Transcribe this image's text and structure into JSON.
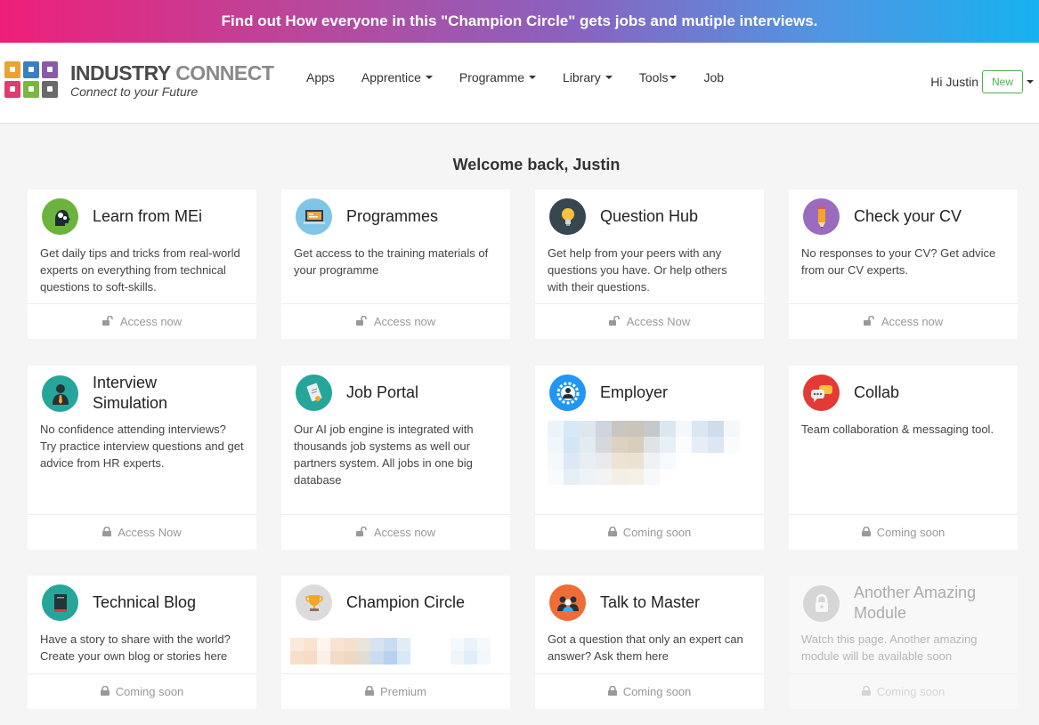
{
  "banner": {
    "text": "Find out How everyone in this \"Champion Circle\" gets jobs and mutiple interviews."
  },
  "logo": {
    "title_part1": "INDUSTRY",
    "title_part2": "CONNECT",
    "subtitle": "Connect to your Future",
    "colors": [
      "#e8a433",
      "#3a7fc1",
      "#8a5aa8",
      "#e23b6f",
      "#7ab73e",
      "#6a6a6a"
    ]
  },
  "nav": {
    "items": [
      {
        "label": "Apps",
        "dropdown": false
      },
      {
        "label": "Apprentice",
        "dropdown": true
      },
      {
        "label": "Programme",
        "dropdown": true
      },
      {
        "label": "Library",
        "dropdown": true
      },
      {
        "label": "Tools",
        "dropdown": true
      },
      {
        "label": "Job",
        "dropdown": false
      }
    ]
  },
  "user": {
    "greeting": "Hi Justin",
    "badge": "New"
  },
  "welcome": "Welcome back, Justin",
  "cards": [
    {
      "title": "Learn from MEi",
      "desc": "Get daily tips and tricks from real-world experts on everything from technical questions to soft-skills.",
      "action": "Access now",
      "icon": "gears-head-icon",
      "color": "#6cb33e",
      "locked": false
    },
    {
      "title": "Programmes",
      "desc": "Get access to the training materials of your programme",
      "action": "Access now",
      "icon": "laptop-icon",
      "color": "#7fc6e6",
      "locked": false
    },
    {
      "title": "Question Hub",
      "desc": "Get help from your peers with any questions you have. Or help others with their questions.",
      "action": "Access Now",
      "icon": "lightbulb-icon",
      "color": "#37474f",
      "locked": false
    },
    {
      "title": "Check your CV",
      "desc": "No responses to your CV? Get advice from our CV experts.",
      "action": "Access now",
      "icon": "pencil-icon",
      "color": "#9b6bbf",
      "locked": false
    },
    {
      "title": "Interview Simulation",
      "desc": "No confidence attending interviews? Try practice interview questions and get advice from HR experts.",
      "action": "Access Now",
      "icon": "interviewer-icon",
      "color": "#26a69a",
      "locked": true
    },
    {
      "title": "Job Portal",
      "desc": "Our AI job engine is integrated with thousands job systems as well our partners system. All jobs in one big database",
      "action": "Access now",
      "icon": "certificate-icon",
      "color": "#26a69a",
      "locked": false
    },
    {
      "title": "Employer",
      "desc": "",
      "action": "Coming soon",
      "icon": "employer-gear-icon",
      "color": "#2196f3",
      "locked": true
    },
    {
      "title": "Collab",
      "desc": "Team collaboration & messaging tool.",
      "action": "Coming soon",
      "icon": "chat-bubbles-icon",
      "color": "#e53935",
      "locked": true
    },
    {
      "title": "Technical Blog",
      "desc": "Have a story to share with the world? Create your own blog or stories here",
      "action": "Coming soon",
      "icon": "book-icon",
      "color": "#26a69a",
      "locked": true
    },
    {
      "title": "Champion Circle",
      "desc": "",
      "action": "Premium",
      "icon": "trophy-icon",
      "color": "#cccccc",
      "locked": true
    },
    {
      "title": "Talk to Master",
      "desc": "Got a question that only an expert can answer? Ask them here",
      "action": "Coming soon",
      "icon": "group-icon",
      "color": "#ef6c36",
      "locked": true
    },
    {
      "title": "Another Amazing Module",
      "desc": "Watch this page. Another amazing module will be available soon",
      "action": "Coming soon",
      "icon": "padlock-icon",
      "color": "#9e9e9e",
      "locked": true
    }
  ]
}
